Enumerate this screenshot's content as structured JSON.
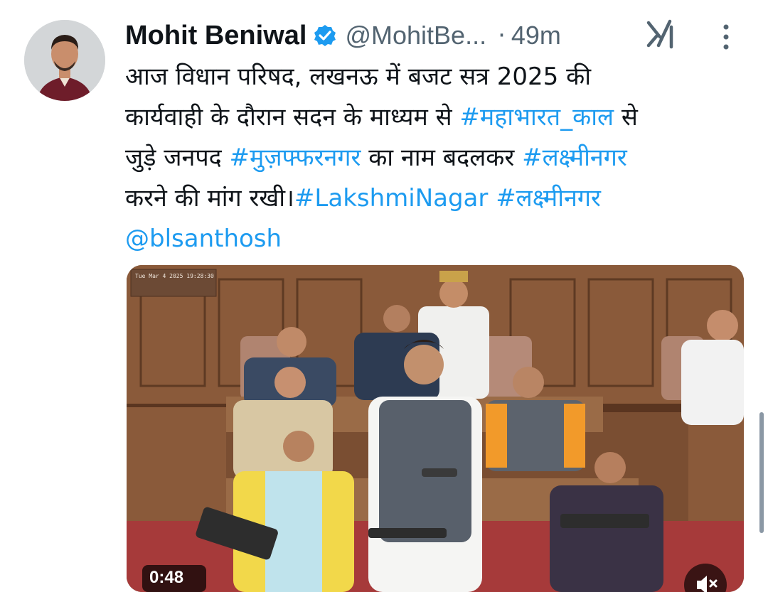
{
  "tweet": {
    "author_name": "Mohit Beniwal",
    "handle": "@MohitBe...",
    "separator": "·",
    "time": "49m",
    "verified_icon": "verified-badge-icon",
    "grok_icon": "grok-icon",
    "more_icon": "more-options-icon",
    "text_lines": [
      [
        {
          "t": "आज विधान परिषद, लखनऊ में बजट सत्र 2025 की",
          "link": false
        }
      ],
      [
        {
          "t": "कार्यवाही के दौरान सदन के माध्यम से ",
          "link": false
        },
        {
          "t": "#महाभारत_काल",
          "link": true
        },
        {
          "t": " से",
          "link": false
        }
      ],
      [
        {
          "t": "जुड़े जनपद ",
          "link": false
        },
        {
          "t": "#मुज़फ्फरनगर",
          "link": true
        },
        {
          "t": " का नाम बदलकर ",
          "link": false
        },
        {
          "t": "#लक्ष्मीनगर",
          "link": true
        }
      ],
      [
        {
          "t": "करने की मांग रखी।",
          "link": false
        },
        {
          "t": "#LakshmiNagar",
          "link": true
        },
        {
          "t": " ",
          "link": false
        },
        {
          "t": "#लक्ष्मीनगर",
          "link": true
        }
      ],
      [
        {
          "t": "@blsanthosh",
          "link": true
        }
      ]
    ],
    "video": {
      "timestamp_overlay": "Tue Mar 4 2025 19:28:30",
      "duration": "0:48",
      "mute_icon": "volume-muted-icon"
    }
  },
  "colors": {
    "link": "#1d9bf0",
    "secondary_text": "#536471",
    "verified": "#1d9bf0"
  }
}
